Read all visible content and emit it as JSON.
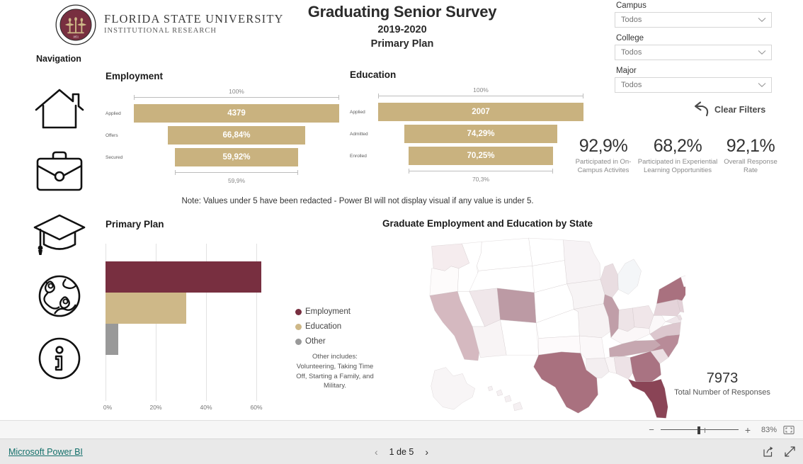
{
  "brand": {
    "org_line1": "FLORIDA STATE UNIVERSITY",
    "org_line2": "INSTITUTIONAL RESEARCH",
    "garnet": "#782F40",
    "gold": "#CEB888",
    "gray": "#999999"
  },
  "header": {
    "title": "Graduating Senior Survey",
    "subtitle": "2019-2020",
    "subtitle2": "Primary Plan"
  },
  "filters": {
    "items": [
      {
        "label": "Campus",
        "value": "Todos"
      },
      {
        "label": "College",
        "value": "Todos"
      },
      {
        "label": "Major",
        "value": "Todos"
      }
    ],
    "clear_label": "Clear Filters"
  },
  "navigation": {
    "title": "Navigation",
    "items": [
      {
        "name": "home",
        "label": "Home"
      },
      {
        "name": "briefcase",
        "label": "Employment"
      },
      {
        "name": "graduation-cap",
        "label": "Education"
      },
      {
        "name": "globe",
        "label": "Map"
      },
      {
        "name": "info",
        "label": "Information"
      }
    ]
  },
  "note": "Note: Values under 5 have been redacted - Power BI will not display visual if any value is under 5.",
  "kpis": [
    {
      "value": "92,9%",
      "caption": "Participated in On-Campus Activites"
    },
    {
      "value": "68,2%",
      "caption": "Participated in Experiential Learning Opportunities"
    },
    {
      "value": "92,1%",
      "caption": "Overall Response Rate"
    }
  ],
  "total_responses": {
    "value": "7973",
    "caption": "Total Number of Responses"
  },
  "map": {
    "title": "Graduate Employment and Education by State"
  },
  "statusbar": {
    "zoom_percent": "83%",
    "minus": "−",
    "plus": "+",
    "page_text": "1 de 5",
    "prev": "‹",
    "next": "›",
    "powerbi_link": "Microsoft Power BI"
  },
  "chart_data": [
    {
      "type": "bar",
      "orientation": "funnel",
      "title": "Employment",
      "top_label": "100%",
      "bottom_label": "59,9%",
      "categories": [
        "Applied",
        "Offers",
        "Secured"
      ],
      "labels": [
        "4379",
        "66,84%",
        "59,92%"
      ],
      "values": [
        100,
        66.84,
        59.92
      ],
      "xlabel": "",
      "ylabel": "",
      "ylim": [
        0,
        100
      ],
      "color": "#C9B27F",
      "grid": false,
      "legend": "none"
    },
    {
      "type": "bar",
      "orientation": "funnel",
      "title": "Education",
      "top_label": "100%",
      "bottom_label": "70,3%",
      "categories": [
        "Applied",
        "Admitted",
        "Enrolled"
      ],
      "labels": [
        "2007",
        "74,29%",
        "70,25%"
      ],
      "values": [
        100,
        74.29,
        70.25
      ],
      "xlabel": "",
      "ylabel": "",
      "ylim": [
        0,
        100
      ],
      "color": "#C9B27F",
      "grid": false,
      "legend": "none"
    },
    {
      "type": "bar",
      "orientation": "horizontal",
      "title": "Primary Plan",
      "categories": [
        "Employment",
        "Education",
        "Other"
      ],
      "values": [
        62.0,
        32.0,
        5.0
      ],
      "colors": [
        "#782F40",
        "#CEB888",
        "#999999"
      ],
      "xlabel": "",
      "ylabel": "",
      "xlim": [
        0,
        69
      ],
      "xticks": [
        0,
        20,
        40,
        60
      ],
      "xticklabels": [
        "0%",
        "20%",
        "40%",
        "60%"
      ],
      "grid": true,
      "legend_position": "right",
      "legend": [
        {
          "label": "Employment",
          "color": "#782F40"
        },
        {
          "label": "Education",
          "color": "#CEB888"
        },
        {
          "label": "Other",
          "color": "#999999"
        }
      ],
      "annotation": "Other includes: Volunteering, Taking Time Off, Starting a Family, and Military."
    },
    {
      "type": "heatmap",
      "subtype": "choropleth",
      "title": "Graduate Employment and Education by State",
      "region": "United States",
      "colorscale_low": "#ffffff",
      "colorscale_high": "#782F40",
      "states": [
        {
          "code": "FL",
          "shade": 1.0
        },
        {
          "code": "GA",
          "shade": 0.72
        },
        {
          "code": "TX",
          "shade": 0.7
        },
        {
          "code": "NY",
          "shade": 0.7
        },
        {
          "code": "NC",
          "shade": 0.52
        },
        {
          "code": "CO",
          "shade": 0.5
        },
        {
          "code": "CA",
          "shade": 0.42
        },
        {
          "code": "TN",
          "shade": 0.4
        },
        {
          "code": "IL",
          "shade": 0.4
        },
        {
          "code": "MA",
          "shade": 0.38
        },
        {
          "code": "VA",
          "shade": 0.3
        },
        {
          "code": "PA",
          "shade": 0.26
        },
        {
          "code": "MD",
          "shade": 0.22
        },
        {
          "code": "AL",
          "shade": 0.2
        },
        {
          "code": "SC",
          "shade": 0.2
        },
        {
          "code": "WI",
          "shade": 0.18
        },
        {
          "code": "OH",
          "shade": 0.14
        },
        {
          "code": "IN",
          "shade": 0.14
        },
        {
          "code": "UT",
          "shade": 0.12
        },
        {
          "code": "AZ",
          "shade": 0.1
        },
        {
          "code": "WA",
          "shade": 0.12
        },
        {
          "code": "NJ",
          "shade": 0.2
        },
        {
          "code": "CT",
          "shade": 0.22
        },
        {
          "code": "LA",
          "shade": 0.12
        },
        {
          "code": "MO",
          "shade": 0.1
        },
        {
          "code": "IA",
          "shade": 0.08
        },
        {
          "code": "MN",
          "shade": 0.08
        },
        {
          "code": "MI",
          "shade": 0.08
        },
        {
          "code": "KY",
          "shade": 0.06
        },
        {
          "code": "AR",
          "shade": 0.04
        },
        {
          "code": "OK",
          "shade": 0.04
        },
        {
          "code": "MS",
          "shade": 0.04
        },
        {
          "code": "WV",
          "shade": 0.04
        },
        {
          "code": "DE",
          "shade": 0.1
        },
        {
          "code": "NV",
          "shade": 0.02
        },
        {
          "code": "OR",
          "shade": 0.02
        },
        {
          "code": "ID",
          "shade": 0.0
        },
        {
          "code": "MT",
          "shade": 0.0
        },
        {
          "code": "WY",
          "shade": 0.0
        },
        {
          "code": "ND",
          "shade": 0.0
        },
        {
          "code": "SD",
          "shade": 0.0
        },
        {
          "code": "NE",
          "shade": 0.0
        },
        {
          "code": "KS",
          "shade": 0.0
        },
        {
          "code": "NM",
          "shade": 0.0
        },
        {
          "code": "ME",
          "shade": 0.0
        },
        {
          "code": "NH",
          "shade": 0.0
        },
        {
          "code": "VT",
          "shade": 0.0
        },
        {
          "code": "RI",
          "shade": 0.0
        },
        {
          "code": "AK",
          "shade": 0.02
        },
        {
          "code": "HI",
          "shade": 0.04
        }
      ]
    }
  ]
}
